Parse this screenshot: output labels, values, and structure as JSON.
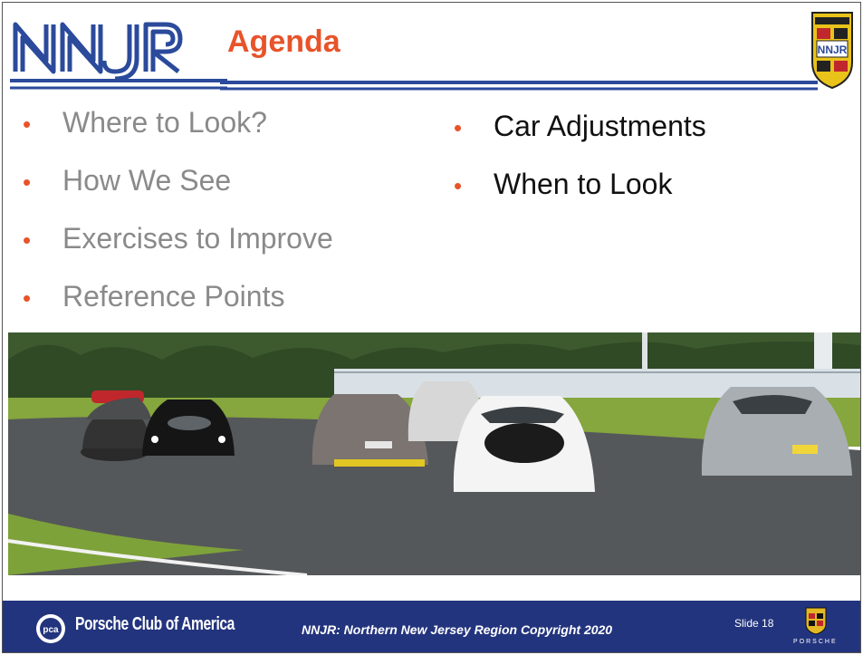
{
  "header": {
    "logo_text": "NNJR",
    "title": "Agenda",
    "crest_text": "NNJR"
  },
  "agenda": {
    "left_items": [
      {
        "label": "Where to Look?"
      },
      {
        "label": "How We See"
      },
      {
        "label": "Exercises to Improve"
      },
      {
        "label": "Reference Points"
      }
    ],
    "right_items": [
      {
        "label": "Car Adjustments"
      },
      {
        "label": "When to Look"
      }
    ],
    "bullet": "•"
  },
  "photo": {
    "icon": "race-track-photo"
  },
  "footer": {
    "pca_badge": "pca",
    "pca_name": "Porsche Club of America",
    "copyright": "NNJR: Northern New Jersey Region Copyright 2020",
    "slide_number": "Slide 18",
    "porsche_word": "PORSCHE"
  },
  "colors": {
    "accent": "#e8532a",
    "footer_bg": "#23347e",
    "logo_blue": "#2b4a9b",
    "muted_text": "#8a8a8a"
  }
}
